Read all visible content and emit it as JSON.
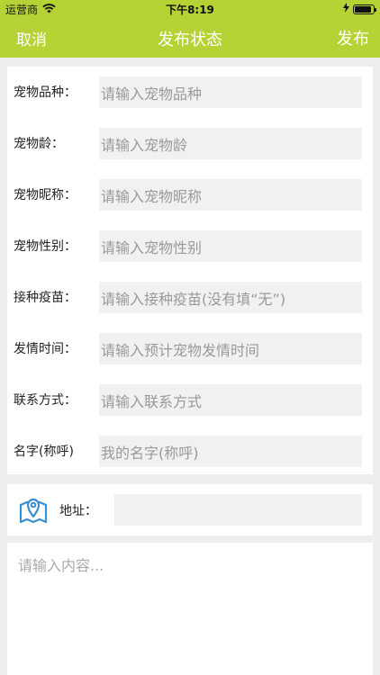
{
  "status_bar": {
    "carrier": "运营商",
    "time": "下午8:19",
    "battery_level": 0.9
  },
  "nav": {
    "cancel_label": "取消",
    "title": "发布状态",
    "publish_label": "发布"
  },
  "form": {
    "fields": [
      {
        "label": "宠物品种：",
        "placeholder": "请输入宠物品种"
      },
      {
        "label": "宠物龄：",
        "placeholder": "请输入宠物龄"
      },
      {
        "label": "宠物昵称：",
        "placeholder": "请输入宠物昵称"
      },
      {
        "label": "宠物性别：",
        "placeholder": "请输入宠物性别"
      },
      {
        "label": "接种疫苗：",
        "placeholder": "请输入接种疫苗(没有填“无”)"
      },
      {
        "label": "发情时间：",
        "placeholder": "请输入预计宠物发情时间"
      },
      {
        "label": "联系方式：",
        "placeholder": "请输入联系方式"
      },
      {
        "label": "名字(称呼)",
        "placeholder": "我的名字(称呼)"
      }
    ]
  },
  "address": {
    "label": "地址：",
    "value": ""
  },
  "content": {
    "placeholder": "请输入内容..."
  },
  "colors": {
    "brand": "#b5d334",
    "input_bg": "#f1f1f3",
    "icon_blue": "#3a8fd0"
  },
  "icons": {
    "signal": "wifi-icon",
    "battery": "battery-icon",
    "charging": "lightning-icon",
    "address": "map-pin-icon"
  }
}
